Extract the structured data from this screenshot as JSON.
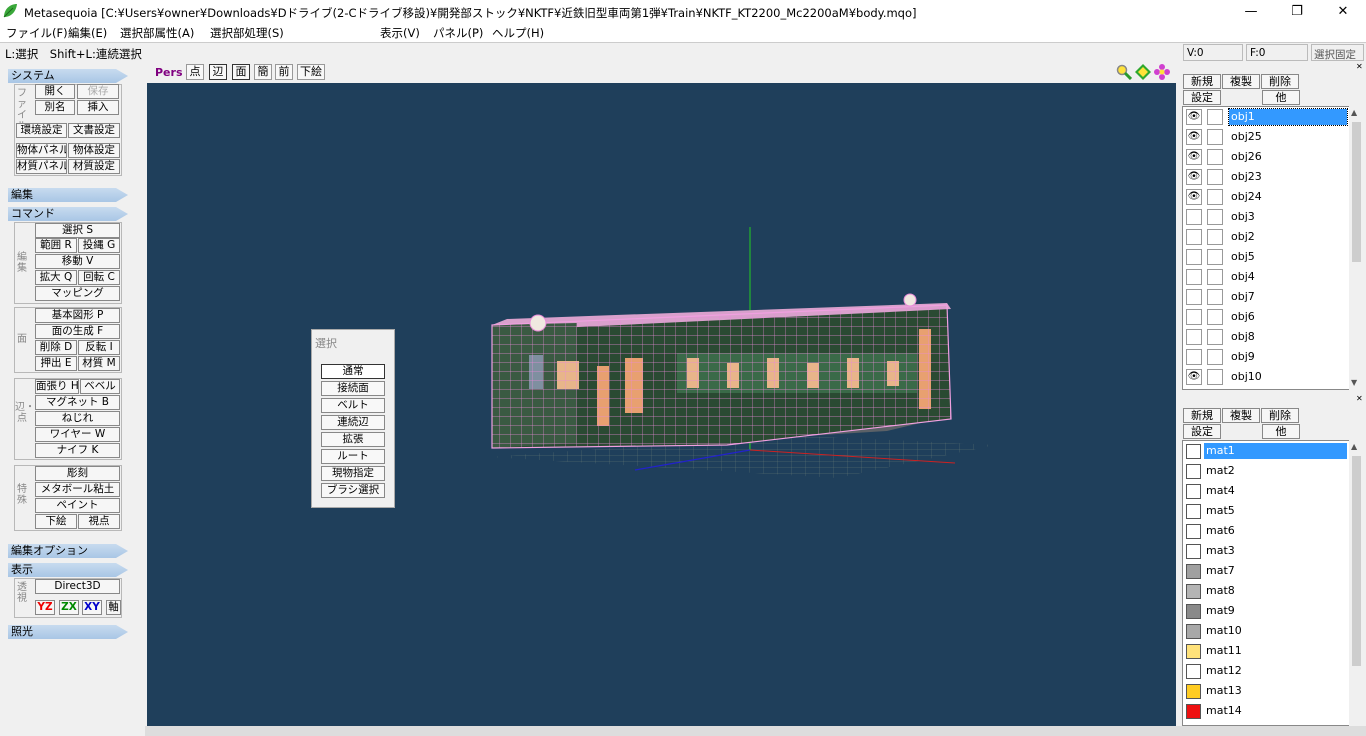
{
  "window": {
    "title": "Metasequoia [C:¥Users¥owner¥Downloads¥Dドライブ(2-Cドライブ移設)¥開発部ストック¥NKTF¥近鉄旧型車両第1弾¥Train¥NKTF_KT2200_Mc2200aM¥body.mqo]",
    "minimize": "—",
    "maximize": "❐",
    "close": "✕"
  },
  "menu": [
    "ファイル(F)",
    "編集(E)",
    "選択部属性(A)",
    "選択部処理(S)",
    "表示(V)",
    "パネル(P)",
    "ヘルプ(H)"
  ],
  "status": {
    "hint": "L:選択　Shift+L:連続選択",
    "vertices": "V:0",
    "faces": "F:0",
    "select_fixed": "選択固定"
  },
  "left": {
    "system": "システム",
    "file_label": "ファイル",
    "open": "開く",
    "save": "保存",
    "save_as": "別名",
    "insert": "挿入",
    "env_settings": "環境設定",
    "doc_settings": "文書設定",
    "obj_panel": "物体パネル",
    "obj_settings": "物体設定",
    "mat_panel": "材質パネル",
    "mat_settings": "材質設定",
    "edit": "編集",
    "command": "コマンド",
    "edit_label": "編集",
    "select": "選択 S",
    "range": "範囲 R",
    "lasso": "投縄 G",
    "move": "移動 V",
    "scale": "拡大 Q",
    "rotate": "回転 C",
    "mapping": "マッピング",
    "face_label": "面",
    "primitive": "基本図形 P",
    "face_gen": "面の生成 F",
    "delete": "削除 D",
    "flip": "反転 I",
    "extrude": "押出 E",
    "material": "材質 M",
    "edge_label": "辺・点",
    "face_stretch": "面張り H",
    "bevel": "ベベル",
    "magnet": "マグネット B",
    "twist": "ねじれ",
    "wire": "ワイヤー W",
    "knife": "ナイフ K",
    "special_label": "特殊",
    "sculpt": "彫刻",
    "metaball": "メタボール粘土",
    "paint": "ペイント",
    "underlay": "下絵",
    "viewpoint": "視点",
    "edit_options": "編集オプション",
    "display": "表示",
    "display_label": "透視",
    "direct3d": "Direct3D",
    "yz": "YZ",
    "zx": "ZX",
    "xy": "XY",
    "axis": "軸",
    "lighting": "照光"
  },
  "toolbar": {
    "pers": "Pers",
    "point": "点",
    "edge": "辺",
    "face": "面",
    "simple": "簡",
    "front": "前",
    "underlay": "下絵"
  },
  "select_panel": {
    "title": "選択",
    "buttons": [
      "通常",
      "接続面",
      "ベルト",
      "連続辺",
      "拡張",
      "ルート",
      "現物指定",
      "ブラシ選択"
    ]
  },
  "objects_panel": {
    "new": "新規",
    "copy": "複製",
    "delete": "削除",
    "settings": "設定",
    "other": "他",
    "items": [
      {
        "name": "obj1",
        "visible": true,
        "selected": true
      },
      {
        "name": "obj25",
        "visible": true
      },
      {
        "name": "obj26",
        "visible": true
      },
      {
        "name": "obj23",
        "visible": true
      },
      {
        "name": "obj24",
        "visible": true
      },
      {
        "name": "obj3",
        "visible": false
      },
      {
        "name": "obj2",
        "visible": false
      },
      {
        "name": "obj5",
        "visible": false
      },
      {
        "name": "obj4",
        "visible": false
      },
      {
        "name": "obj7",
        "visible": false
      },
      {
        "name": "obj6",
        "visible": false
      },
      {
        "name": "obj8",
        "visible": false
      },
      {
        "name": "obj9",
        "visible": false
      },
      {
        "name": "obj10",
        "visible": true
      }
    ]
  },
  "materials_panel": {
    "new": "新規",
    "copy": "複製",
    "delete": "削除",
    "settings": "設定",
    "other": "他",
    "items": [
      {
        "name": "mat1",
        "color": "#ffffff",
        "selected": true
      },
      {
        "name": "mat2",
        "color": "#ffffff"
      },
      {
        "name": "mat4",
        "color": "#ffffff"
      },
      {
        "name": "mat5",
        "color": "#ffffff"
      },
      {
        "name": "mat6",
        "color": "#ffffff"
      },
      {
        "name": "mat3",
        "color": "#ffffff"
      },
      {
        "name": "mat7",
        "color": "#a0a0a0"
      },
      {
        "name": "mat8",
        "color": "#b4b4b4"
      },
      {
        "name": "mat9",
        "color": "#8a8a8a"
      },
      {
        "name": "mat10",
        "color": "#a8a8a8"
      },
      {
        "name": "mat11",
        "color": "#ffe27a"
      },
      {
        "name": "mat12",
        "color": "#ffffff"
      },
      {
        "name": "mat13",
        "color": "#ffcc22"
      },
      {
        "name": "mat14",
        "color": "#ee1111"
      }
    ]
  }
}
